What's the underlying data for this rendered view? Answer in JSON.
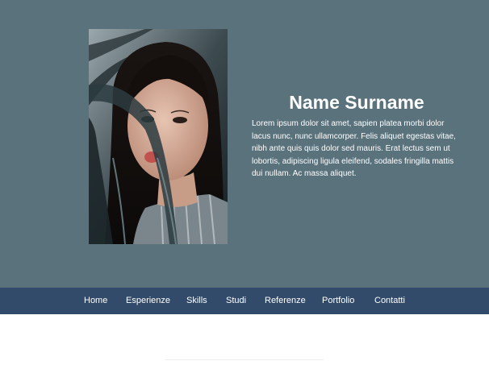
{
  "hero": {
    "name": "Name Surname",
    "bio": "Lorem ipsum dolor sit amet, sapien platea morbi dolor lacus nunc, nunc ullamcorper. Felis aliquet egestas vitae, nibh ante quis quis dolor sed mauris. Erat lectus sem ut lobortis, adipiscing ligula eleifend, sodales fringilla mattis dui nullam. Ac massa aliquet."
  },
  "nav": {
    "items": [
      {
        "label": "Home"
      },
      {
        "label": "Esperienze"
      },
      {
        "label": "Skills"
      },
      {
        "label": "Studi"
      },
      {
        "label": "Referenze"
      },
      {
        "label": "Portfolio"
      },
      {
        "label": "Contatti"
      }
    ]
  },
  "colors": {
    "hero_background": "#5a727c",
    "navbar_background": "#324b6a",
    "text": "#ffffff"
  }
}
